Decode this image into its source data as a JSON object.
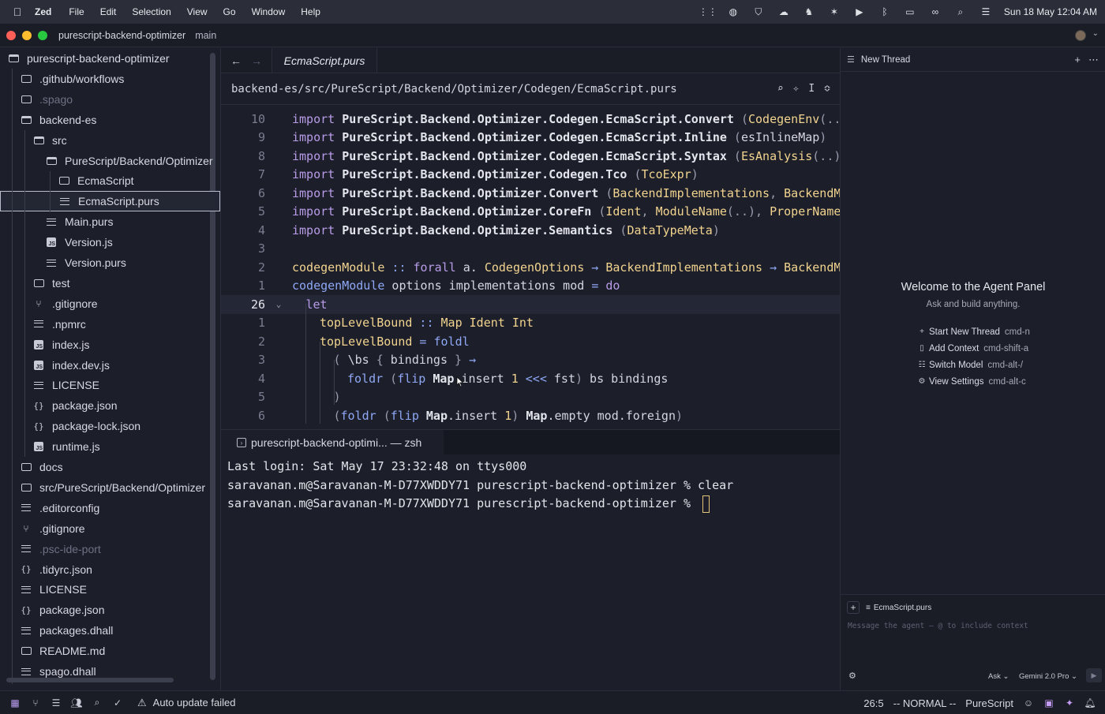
{
  "menubar": {
    "app": "Zed",
    "items": [
      "File",
      "Edit",
      "Selection",
      "View",
      "Go",
      "Window",
      "Help"
    ],
    "datetime": "Sun 18 May  12:04 AM"
  },
  "titlebar": {
    "project": "purescript-backend-optimizer",
    "branch": "main"
  },
  "project_tree": [
    {
      "label": "purescript-backend-optimizer",
      "icon": "folder-open-icon",
      "depth": 0
    },
    {
      "label": ".github/workflows",
      "icon": "folder-icon",
      "depth": 1
    },
    {
      "label": ".spago",
      "icon": "folder-icon",
      "depth": 1,
      "dim": true
    },
    {
      "label": "backend-es",
      "icon": "folder-open-icon",
      "depth": 1
    },
    {
      "label": "src",
      "icon": "folder-open-icon",
      "depth": 2
    },
    {
      "label": "PureScript/Backend/Optimizer",
      "icon": "folder-open-icon",
      "depth": 3
    },
    {
      "label": "EcmaScript",
      "icon": "folder-icon",
      "depth": 4
    },
    {
      "label": "EcmaScript.purs",
      "icon": "file-lines-icon",
      "depth": 4,
      "selected": true
    },
    {
      "label": "Main.purs",
      "icon": "file-lines-icon",
      "depth": 3
    },
    {
      "label": "Version.js",
      "icon": "js-file-icon",
      "depth": 3
    },
    {
      "label": "Version.purs",
      "icon": "file-lines-icon",
      "depth": 3
    },
    {
      "label": "test",
      "icon": "folder-icon",
      "depth": 2
    },
    {
      "label": ".gitignore",
      "icon": "git-icon",
      "depth": 2
    },
    {
      "label": ".npmrc",
      "icon": "file-lines-icon",
      "depth": 2
    },
    {
      "label": "index.js",
      "icon": "js-file-icon",
      "depth": 2
    },
    {
      "label": "index.dev.js",
      "icon": "js-file-icon",
      "depth": 2
    },
    {
      "label": "LICENSE",
      "icon": "file-lines-icon",
      "depth": 2
    },
    {
      "label": "package.json",
      "icon": "braces-icon",
      "depth": 2
    },
    {
      "label": "package-lock.json",
      "icon": "braces-icon",
      "depth": 2
    },
    {
      "label": "runtime.js",
      "icon": "js-file-icon",
      "depth": 2
    },
    {
      "label": "docs",
      "icon": "folder-icon",
      "depth": 1
    },
    {
      "label": "src/PureScript/Backend/Optimizer",
      "icon": "folder-icon",
      "depth": 1
    },
    {
      "label": ".editorconfig",
      "icon": "file-lines-icon",
      "depth": 1
    },
    {
      "label": ".gitignore",
      "icon": "git-icon",
      "depth": 1
    },
    {
      "label": ".psc-ide-port",
      "icon": "file-lines-icon",
      "depth": 1,
      "dim": true
    },
    {
      "label": ".tidyrc.json",
      "icon": "braces-icon",
      "depth": 1
    },
    {
      "label": "LICENSE",
      "icon": "file-lines-icon",
      "depth": 1
    },
    {
      "label": "package.json",
      "icon": "braces-icon",
      "depth": 1
    },
    {
      "label": "packages.dhall",
      "icon": "file-lines-icon",
      "depth": 1
    },
    {
      "label": "README.md",
      "icon": "book-icon",
      "depth": 1
    },
    {
      "label": "spago.dhall",
      "icon": "file-lines-icon",
      "depth": 1
    }
  ],
  "editor": {
    "tab": "EcmaScript.purs",
    "breadcrumb": "backend-es/src/PureScript/Backend/Optimizer/Codegen/EcmaScript.purs",
    "lines": [
      {
        "n": "10",
        "indent": 0,
        "tokens": [
          [
            "kw",
            "import "
          ],
          [
            "mod",
            "PureScript.Backend.Optimizer.Codegen.EcmaScript.Convert"
          ],
          [
            "punc",
            " ("
          ],
          [
            "typ",
            "CodegenEnv"
          ],
          [
            "punc",
            "(..), "
          ]
        ]
      },
      {
        "n": "9",
        "indent": 0,
        "tokens": [
          [
            "kw",
            "import "
          ],
          [
            "mod",
            "PureScript.Backend.Optimizer.Codegen.EcmaScript.Inline"
          ],
          [
            "punc",
            " ("
          ],
          [
            "var",
            "esInlineMap"
          ],
          [
            "punc",
            ")"
          ]
        ]
      },
      {
        "n": "8",
        "indent": 0,
        "tokens": [
          [
            "kw",
            "import "
          ],
          [
            "mod",
            "PureScript.Backend.Optimizer.Codegen.EcmaScript.Syntax"
          ],
          [
            "punc",
            " ("
          ],
          [
            "typ",
            "EsAnalysis"
          ],
          [
            "punc",
            "(..), "
          ],
          [
            "typ",
            "E"
          ]
        ]
      },
      {
        "n": "7",
        "indent": 0,
        "tokens": [
          [
            "kw",
            "import "
          ],
          [
            "mod",
            "PureScript.Backend.Optimizer.Codegen.Tco"
          ],
          [
            "punc",
            " ("
          ],
          [
            "typ",
            "TcoExpr"
          ],
          [
            "punc",
            ")"
          ]
        ]
      },
      {
        "n": "6",
        "indent": 0,
        "tokens": [
          [
            "kw",
            "import "
          ],
          [
            "mod",
            "PureScript.Backend.Optimizer.Convert"
          ],
          [
            "punc",
            " ("
          ],
          [
            "typ",
            "BackendImplementations"
          ],
          [
            "punc",
            ", "
          ],
          [
            "typ",
            "BackendModu"
          ]
        ]
      },
      {
        "n": "5",
        "indent": 0,
        "tokens": [
          [
            "kw",
            "import "
          ],
          [
            "mod",
            "PureScript.Backend.Optimizer.CoreFn"
          ],
          [
            "punc",
            " ("
          ],
          [
            "typ",
            "Ident"
          ],
          [
            "punc",
            ", "
          ],
          [
            "typ",
            "ModuleName"
          ],
          [
            "punc",
            "(..), "
          ],
          [
            "typ",
            "ProperName"
          ],
          [
            "punc",
            ", "
          ],
          [
            "typ",
            "("
          ]
        ]
      },
      {
        "n": "4",
        "indent": 0,
        "tokens": [
          [
            "kw",
            "import "
          ],
          [
            "mod",
            "PureScript.Backend.Optimizer.Semantics"
          ],
          [
            "punc",
            " ("
          ],
          [
            "typ",
            "DataTypeMeta"
          ],
          [
            "punc",
            ")"
          ]
        ]
      },
      {
        "n": "3",
        "indent": 0,
        "tokens": []
      },
      {
        "n": "2",
        "indent": 0,
        "tokens": [
          [
            "fn",
            "codegenModule"
          ],
          [
            "op",
            " :: "
          ],
          [
            "kw",
            "forall"
          ],
          [
            "var",
            " a. "
          ],
          [
            "typ",
            "CodegenOptions"
          ],
          [
            "op",
            " → "
          ],
          [
            "typ",
            "BackendImplementations"
          ],
          [
            "op",
            " → "
          ],
          [
            "typ",
            "BackendMo"
          ]
        ]
      },
      {
        "n": "1",
        "indent": 0,
        "tokens": [
          [
            "lib",
            "codegenModule"
          ],
          [
            "var",
            " options implementations mod "
          ],
          [
            "op",
            "="
          ],
          [
            "kw",
            " do"
          ]
        ]
      },
      {
        "n": "26",
        "indent": 1,
        "current": true,
        "fold": true,
        "tokens": [
          [
            "kw",
            "let"
          ]
        ]
      },
      {
        "n": "1",
        "indent": 2,
        "tokens": [
          [
            "fn",
            "topLevelBound"
          ],
          [
            "op",
            " :: "
          ],
          [
            "typ",
            "Map Ident Int"
          ]
        ]
      },
      {
        "n": "2",
        "indent": 2,
        "tokens": [
          [
            "fn",
            "topLevelBound"
          ],
          [
            "op",
            " = "
          ],
          [
            "lib",
            "foldl"
          ]
        ]
      },
      {
        "n": "3",
        "indent": 3,
        "tokens": [
          [
            "punc",
            "( "
          ],
          [
            "var",
            "\\bs "
          ],
          [
            "punc",
            "{ "
          ],
          [
            "var",
            "bindings "
          ],
          [
            "punc",
            "}"
          ],
          [
            "op",
            " →"
          ]
        ]
      },
      {
        "n": "4",
        "indent": 4,
        "tokens": [
          [
            "lib",
            "foldr"
          ],
          [
            "punc",
            " ("
          ],
          [
            "lib",
            "flip "
          ],
          [
            "mod",
            "Map"
          ],
          [
            "var",
            ".insert "
          ],
          [
            "num",
            "1"
          ],
          [
            "op",
            " <<< "
          ],
          [
            "var",
            "fst"
          ],
          [
            "punc",
            ")"
          ],
          [
            "var",
            " bs bindings"
          ]
        ]
      },
      {
        "n": "5",
        "indent": 3,
        "tokens": [
          [
            "punc",
            ")"
          ]
        ]
      },
      {
        "n": "6",
        "indent": 3,
        "tokens": [
          [
            "punc",
            "("
          ],
          [
            "lib",
            "foldr"
          ],
          [
            "punc",
            " ("
          ],
          [
            "lib",
            "flip "
          ],
          [
            "mod",
            "Map"
          ],
          [
            "var",
            ".insert "
          ],
          [
            "num",
            "1"
          ],
          [
            "punc",
            ") "
          ],
          [
            "mod",
            "Map"
          ],
          [
            "var",
            ".empty mod.foreign"
          ],
          [
            "punc",
            ")"
          ]
        ]
      }
    ]
  },
  "terminal": {
    "tab_label": "purescript-backend-optimi... — zsh",
    "lines": [
      "Last login: Sat May 17 23:32:48 on ttys000",
      "saravanan.m@Saravanan-M-D77XWDDY71 purescript-backend-optimizer % clear",
      "saravanan.m@Saravanan-M-D77XWDDY71 purescript-backend-optimizer % "
    ]
  },
  "agent": {
    "title": "New Thread",
    "welcome_title": "Welcome to the Agent Panel",
    "welcome_sub": "Ask and build anything.",
    "commands": [
      {
        "icon": "plus-icon",
        "label": "Start New Thread",
        "key": "cmd-n"
      },
      {
        "icon": "file-icon",
        "label": "Add Context",
        "key": "cmd-shift-a"
      },
      {
        "icon": "model-icon",
        "label": "Switch Model",
        "key": "cmd-alt-/"
      },
      {
        "icon": "gear-icon",
        "label": "View Settings",
        "key": "cmd-alt-c"
      }
    ],
    "context_file": "EcmaScript.purs",
    "placeholder": "Message the agent – @ to include context",
    "mode": "Ask",
    "model": "Gemini 2.0 Pro"
  },
  "statusbar": {
    "warning": "Auto update failed",
    "position": "26:5",
    "vim_mode": "-- NORMAL --",
    "language": "PureScript"
  }
}
